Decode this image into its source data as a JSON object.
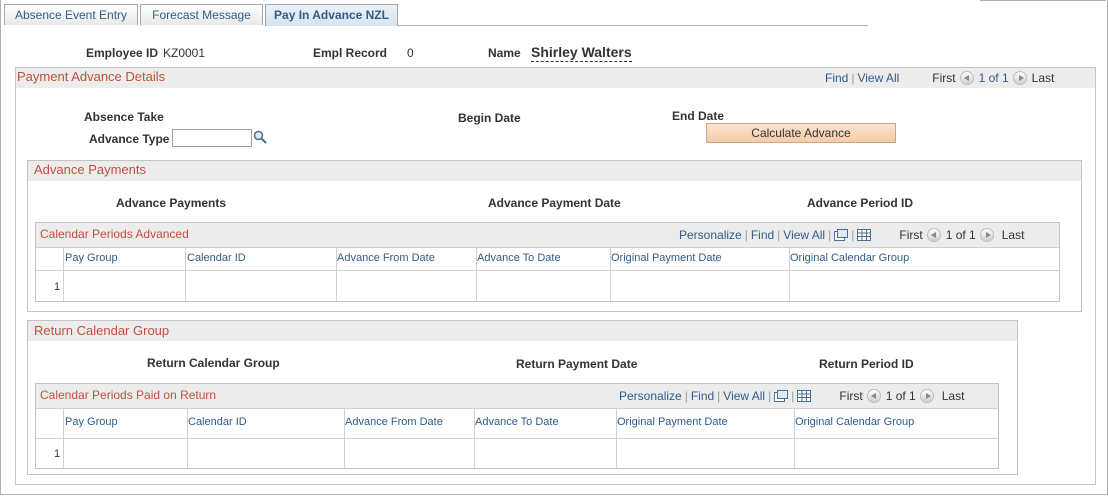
{
  "tabs": [
    {
      "label": "Absence Event Entry"
    },
    {
      "label": "Forecast Message"
    },
    {
      "label": "Pay In Advance NZL"
    }
  ],
  "header": {
    "employee_id_label": "Employee ID",
    "employee_id": "KZ0001",
    "empl_record_label": "Empl Record",
    "empl_record": "0",
    "name_label": "Name",
    "name": "Shirley Walters"
  },
  "payment_details": {
    "title": "Payment Advance Details",
    "find": "Find",
    "view_all": "View All",
    "first": "First",
    "range": "1 of 1",
    "last": "Last",
    "absence_take_label": "Absence Take",
    "begin_date_label": "Begin Date",
    "end_date_label": "End Date",
    "advance_type_label": "Advance Type",
    "advance_type_value": "",
    "calculate_button": "Calculate Advance"
  },
  "advance_payments": {
    "title": "Advance Payments",
    "col1": "Advance Payments",
    "col2": "Advance Payment Date",
    "col3": "Advance Period ID",
    "grid": {
      "title": "Calendar Periods Advanced",
      "personalize": "Personalize",
      "find": "Find",
      "view_all": "View All",
      "first": "First",
      "range": "1 of 1",
      "last": "Last",
      "columns": [
        "Pay Group",
        "Calendar ID",
        "Advance From Date",
        "Advance To Date",
        "Original Payment Date",
        "Original Calendar Group"
      ],
      "rows": [
        {
          "num": "1"
        }
      ]
    }
  },
  "return_calendar": {
    "title": "Return Calendar Group",
    "col1": "Return Calendar Group",
    "col2": "Return Payment Date",
    "col3": "Return Period ID",
    "grid": {
      "title": "Calendar Periods Paid on Return",
      "personalize": "Personalize",
      "find": "Find",
      "view_all": "View All",
      "first": "First",
      "range": "1 of 1",
      "last": "Last",
      "columns": [
        "Pay Group",
        "Calendar ID",
        "Advance From Date",
        "Advance To Date",
        "Original Payment Date",
        "Original Calendar Group"
      ],
      "rows": [
        {
          "num": "1"
        }
      ]
    }
  },
  "colors": {
    "section_title": "#c0503c",
    "link": "#2f5c8a",
    "button": "#f5cca9"
  },
  "icons": [
    "search-icon",
    "zoom-icon",
    "spreadsheet-icon",
    "previous-arrow-icon",
    "next-arrow-icon"
  ]
}
